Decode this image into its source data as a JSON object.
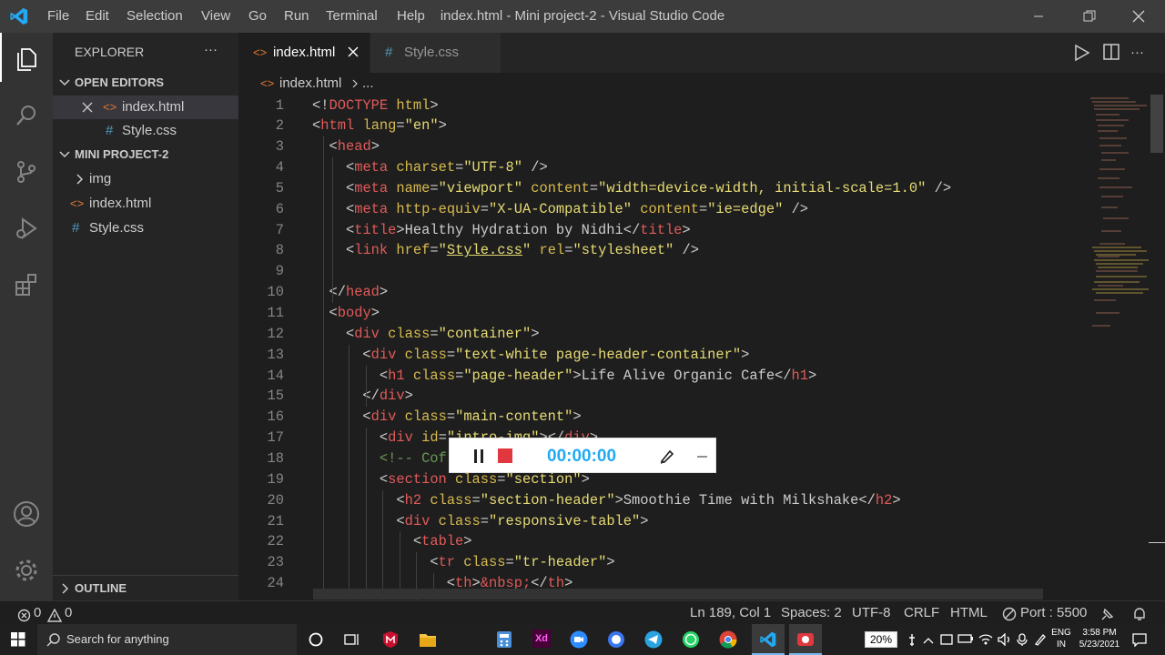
{
  "titlebar": {
    "menus": [
      "File",
      "Edit",
      "Selection",
      "View",
      "Go",
      "Run",
      "Terminal",
      "Help"
    ],
    "title": "index.html - Mini project-2 - Visual Studio Code"
  },
  "sidebar": {
    "explorer_label": "EXPLORER",
    "more": "···",
    "open_editors_label": "OPEN EDITORS",
    "open_editors": [
      {
        "name": "index.html",
        "icon": "html-file-icon"
      },
      {
        "name": "Style.css",
        "icon": "css-file-icon"
      }
    ],
    "project_label": "MINI PROJECT-2",
    "project_items": [
      {
        "name": "img",
        "icon": "folder-chevron"
      },
      {
        "name": "index.html",
        "icon": "html-file-icon"
      },
      {
        "name": "Style.css",
        "icon": "css-file-icon"
      }
    ],
    "outline_label": "OUTLINE"
  },
  "tabs": [
    {
      "label": "index.html",
      "active": true
    },
    {
      "label": "Style.css",
      "active": false
    }
  ],
  "breadcrumb": {
    "file": "index.html",
    "rest": "..."
  },
  "editor": {
    "lines": [
      {
        "n": "1",
        "html": "<span class='p'>&lt;!</span><span class='t'>DOCTYPE</span> <span class='a'>html</span><span class='p'>&gt;</span>"
      },
      {
        "n": "2",
        "html": "<span class='p'>&lt;</span><span class='t'>html</span> <span class='a'>lang</span><span class='p'>=</span><span class='s'>\"en\"</span><span class='p'>&gt;</span>"
      },
      {
        "n": "3",
        "html": "  <span class='p'>&lt;</span><span class='t'>head</span><span class='p'>&gt;</span>"
      },
      {
        "n": "4",
        "html": "    <span class='p'>&lt;</span><span class='t'>meta</span> <span class='a'>charset</span><span class='p'>=</span><span class='s'>\"UTF-8\"</span> <span class='p'>/&gt;</span>"
      },
      {
        "n": "5",
        "html": "    <span class='p'>&lt;</span><span class='t'>meta</span> <span class='a'>name</span><span class='p'>=</span><span class='s'>\"viewport\"</span> <span class='a'>content</span><span class='p'>=</span><span class='s'>\"width=device-width, initial-scale=1.0\"</span> <span class='p'>/&gt;</span>"
      },
      {
        "n": "6",
        "html": "    <span class='p'>&lt;</span><span class='t'>meta</span> <span class='a'>http-equiv</span><span class='p'>=</span><span class='s'>\"X-UA-Compatible\"</span> <span class='a'>content</span><span class='p'>=</span><span class='s'>\"ie=edge\"</span> <span class='p'>/&gt;</span>"
      },
      {
        "n": "7",
        "html": "    <span class='p'>&lt;</span><span class='t'>title</span><span class='p'>&gt;Healthy Hydration by Nidhi&lt;/</span><span class='t'>title</span><span class='p'>&gt;</span>"
      },
      {
        "n": "8",
        "html": "    <span class='p'>&lt;</span><span class='t'>link</span> <span class='a'>href</span><span class='p'>=</span><span class='s'>\"<u>Style.css</u>\"</span> <span class='a'>rel</span><span class='p'>=</span><span class='s'>\"stylesheet\"</span> <span class='p'>/&gt;</span>"
      },
      {
        "n": "9",
        "html": ""
      },
      {
        "n": "10",
        "html": "  <span class='p'>&lt;/</span><span class='t'>head</span><span class='p'>&gt;</span>"
      },
      {
        "n": "11",
        "html": "  <span class='p'>&lt;</span><span class='t'>body</span><span class='p'>&gt;</span>"
      },
      {
        "n": "12",
        "html": "    <span class='p'>&lt;</span><span class='t'>div</span> <span class='a'>class</span><span class='p'>=</span><span class='s'>\"container\"</span><span class='p'>&gt;</span>"
      },
      {
        "n": "13",
        "html": "      <span class='p'>&lt;</span><span class='t'>div</span> <span class='a'>class</span><span class='p'>=</span><span class='s'>\"text-white page-header-container\"</span><span class='p'>&gt;</span>"
      },
      {
        "n": "14",
        "html": "        <span class='p'>&lt;</span><span class='t'>h1</span> <span class='a'>class</span><span class='p'>=</span><span class='s'>\"page-header\"</span><span class='p'>&gt;Life Alive Organic Cafe&lt;/</span><span class='t'>h1</span><span class='p'>&gt;</span>"
      },
      {
        "n": "15",
        "html": "      <span class='p'>&lt;/</span><span class='t'>div</span><span class='p'>&gt;</span>"
      },
      {
        "n": "16",
        "html": "      <span class='p'>&lt;</span><span class='t'>div</span> <span class='a'>class</span><span class='p'>=</span><span class='s'>\"main-content\"</span><span class='p'>&gt;</span>"
      },
      {
        "n": "17",
        "html": "        <span class='p'>&lt;</span><span class='t'>div</span> <span class='a'>id</span><span class='p'>=</span><span class='s'>\"intro-img\"</span><span class='p'>&gt;&lt;/</span><span class='t'>div</span><span class='p'>&gt;</span>"
      },
      {
        "n": "18",
        "html": "        <span class='c'>&lt;!-- Cof</span>"
      },
      {
        "n": "19",
        "html": "        <span class='p'>&lt;</span><span class='t'>section</span> <span class='a'>class</span><span class='p'>=</span><span class='s'>\"section\"</span><span class='p'>&gt;</span>"
      },
      {
        "n": "20",
        "html": "          <span class='p'>&lt;</span><span class='t'>h2</span> <span class='a'>class</span><span class='p'>=</span><span class='s'>\"section-header\"</span><span class='p'>&gt;Smoothie Time with Milkshake&lt;/</span><span class='t'>h2</span><span class='p'>&gt;</span>"
      },
      {
        "n": "21",
        "html": "          <span class='p'>&lt;</span><span class='t'>div</span> <span class='a'>class</span><span class='p'>=</span><span class='s'>\"responsive-table\"</span><span class='p'>&gt;</span>"
      },
      {
        "n": "22",
        "html": "            <span class='p'>&lt;</span><span class='t'>table</span><span class='p'>&gt;</span>"
      },
      {
        "n": "23",
        "html": "              <span class='p'>&lt;</span><span class='t'>tr</span> <span class='a'>class</span><span class='p'>=</span><span class='s'>\"tr-header\"</span><span class='p'>&gt;</span>"
      },
      {
        "n": "24",
        "html": "                <span class='p'>&lt;</span><span class='t'>th</span><span class='p'>&gt;</span><span class='k'>&amp;nbsp;</span><span class='p'>&lt;/</span><span class='t'>th</span><span class='p'>&gt;</span>"
      }
    ]
  },
  "recorder": {
    "time": "00:00:00"
  },
  "statusbar": {
    "errors": "0",
    "warnings": "0",
    "position": "Ln 189, Col 1",
    "spaces": "Spaces: 2",
    "encoding": "UTF-8",
    "eol": "CRLF",
    "language": "HTML",
    "port": "Port : 5500"
  },
  "taskbar": {
    "search_placeholder": "Search for anything",
    "battery": "20%",
    "lang_top": "ENG",
    "lang_bottom": "IN",
    "time": "3:58 PM",
    "date": "5/23/2021"
  },
  "colors": {
    "accent": "#007acc",
    "vscode_blue": "#23a9f2",
    "tag": "#e15a5a",
    "attr": "#d7ba4e",
    "string": "#e6db74"
  }
}
